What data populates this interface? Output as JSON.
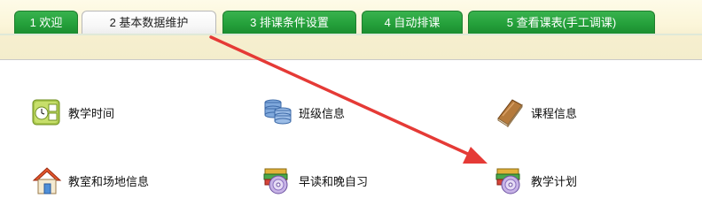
{
  "tabs": [
    {
      "label": "1 欢迎"
    },
    {
      "label": "2 基本数据维护"
    },
    {
      "label": "3 排课条件设置"
    },
    {
      "label": "4 自动排课"
    },
    {
      "label": "5 查看课表(手工调课)"
    }
  ],
  "active_tab_index": 1,
  "items": [
    {
      "label": "教学时间",
      "icon": "teaching-time-icon"
    },
    {
      "label": "班级信息",
      "icon": "database-icon"
    },
    {
      "label": "课程信息",
      "icon": "book-icon"
    },
    {
      "label": "教室和场地信息",
      "icon": "house-icon"
    },
    {
      "label": "早读和晚自习",
      "icon": "cd-books-icon"
    },
    {
      "label": "教学计划",
      "icon": "cd-books-icon"
    }
  ],
  "colors": {
    "tab_green": "#25a13b",
    "arrow_red": "#e53a36",
    "background_header": "#fbf5d8"
  }
}
